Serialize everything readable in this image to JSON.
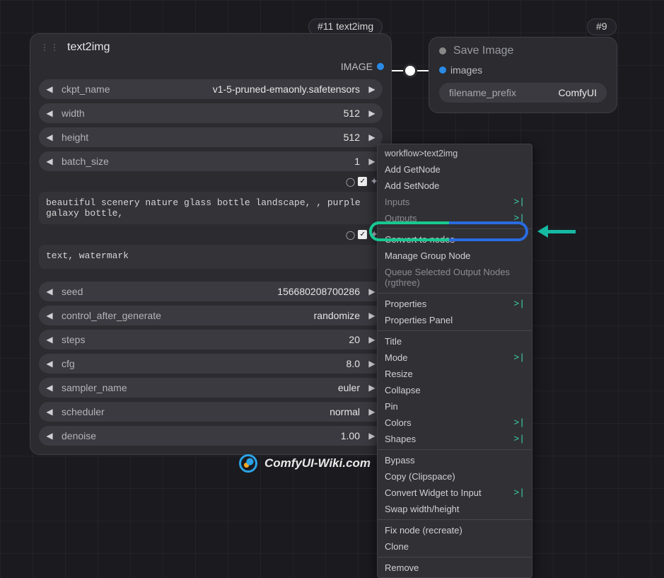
{
  "tags": {
    "left": "#11 text2img",
    "right": "#9"
  },
  "node1": {
    "title": "text2img",
    "output_label": "IMAGE",
    "params_top": [
      {
        "name": "ckpt_name",
        "value": "v1-5-pruned-emaonly.safetensors"
      },
      {
        "name": "width",
        "value": "512"
      },
      {
        "name": "height",
        "value": "512"
      },
      {
        "name": "batch_size",
        "value": "1"
      }
    ],
    "prompt_pos": "beautiful scenery nature glass bottle landscape, , purple galaxy bottle,",
    "prompt_neg": "text, watermark",
    "params_bottom": [
      {
        "name": "seed",
        "value": "156680208700286"
      },
      {
        "name": "control_after_generate",
        "value": "randomize"
      },
      {
        "name": "steps",
        "value": "20"
      },
      {
        "name": "cfg",
        "value": "8.0"
      },
      {
        "name": "sampler_name",
        "value": "euler"
      },
      {
        "name": "scheduler",
        "value": "normal"
      },
      {
        "name": "denoise",
        "value": "1.00"
      }
    ]
  },
  "node2": {
    "title": "Save Image",
    "input_label": "images",
    "param_name": "filename_prefix",
    "param_value": "ComfyUI"
  },
  "ctx": {
    "breadcrumb": "workflow>text2img",
    "items": [
      {
        "t": "Add GetNode"
      },
      {
        "t": "Add SetNode"
      },
      {
        "t": "Inputs",
        "sub": true,
        "dim": true
      },
      {
        "t": "Outputs",
        "sub": true,
        "dim": true
      },
      {
        "sep": true
      },
      {
        "t": "Convert to nodes"
      },
      {
        "t": "Manage Group Node"
      },
      {
        "t": "Queue Selected Output Nodes (rgthree)",
        "dim": true
      },
      {
        "sep": true
      },
      {
        "t": "Properties",
        "sub": true
      },
      {
        "t": "Properties Panel"
      },
      {
        "sep": true
      },
      {
        "t": "Title"
      },
      {
        "t": "Mode",
        "sub": true
      },
      {
        "t": "Resize"
      },
      {
        "t": "Collapse"
      },
      {
        "t": "Pin"
      },
      {
        "t": "Colors",
        "sub": true
      },
      {
        "t": "Shapes",
        "sub": true
      },
      {
        "sep": true
      },
      {
        "t": "Bypass"
      },
      {
        "t": "Copy (Clipspace)"
      },
      {
        "t": "Convert Widget to Input",
        "sub": true
      },
      {
        "t": "Swap width/height"
      },
      {
        "sep": true
      },
      {
        "t": "Fix node (recreate)"
      },
      {
        "t": "Clone"
      },
      {
        "sep": true
      },
      {
        "t": "Remove"
      }
    ]
  },
  "watermark": "ComfyUI-Wiki.com"
}
